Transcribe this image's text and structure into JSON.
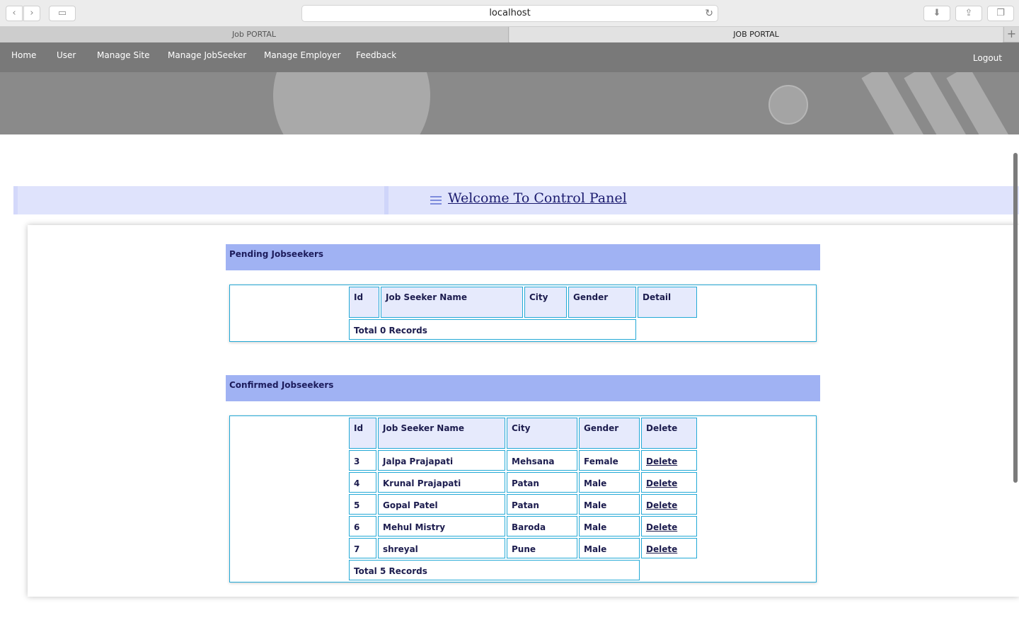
{
  "browser": {
    "url": "localhost",
    "tabs": [
      {
        "label": "Job PORTAL"
      },
      {
        "label": "JOB PORTAL"
      }
    ],
    "icons": {
      "back": "‹",
      "forward": "›",
      "sidebar": "▭",
      "reload": "↻",
      "download": "⬇",
      "share": "⇪",
      "tabs": "❐",
      "new_tab": "+"
    }
  },
  "nav": {
    "items": [
      "Home",
      "User",
      "Manage Site",
      "Manage JobSeeker",
      "Manage Employer",
      "Feedback"
    ],
    "logout": "Logout"
  },
  "welcome": {
    "title": "Welcome To Control Panel"
  },
  "pending": {
    "heading": "Pending Jobseekers",
    "columns": [
      "Id",
      "Job Seeker Name",
      "City",
      "Gender",
      "Detail"
    ],
    "total": "Total 0 Records"
  },
  "confirmed": {
    "heading": "Confirmed Jobseekers",
    "columns": [
      "Id",
      "Job Seeker Name",
      "City",
      "Gender",
      "Delete"
    ],
    "rows": [
      {
        "id": "3",
        "name": "Jalpa Prajapati",
        "city": "Mehsana",
        "gender": "Female",
        "action": "Delete"
      },
      {
        "id": "4",
        "name": "Krunal Prajapati",
        "city": "Patan",
        "gender": "Male",
        "action": "Delete"
      },
      {
        "id": "5",
        "name": "Gopal Patel",
        "city": "Patan",
        "gender": "Male",
        "action": "Delete"
      },
      {
        "id": "6",
        "name": "Mehul Mistry",
        "city": "Baroda",
        "gender": "Male",
        "action": "Delete"
      },
      {
        "id": "7",
        "name": "shreyal",
        "city": "Pune",
        "gender": "Male",
        "action": "Delete"
      }
    ],
    "total": "Total 5 Records"
  },
  "colors": {
    "nav_bg": "#797979",
    "welcome_bg": "#dfe3fc",
    "section_head_bg": "#a0b2f3",
    "table_border": "#23a9d6",
    "header_cell_bg": "#e6eafc",
    "text_dark": "#1c1c4e"
  }
}
